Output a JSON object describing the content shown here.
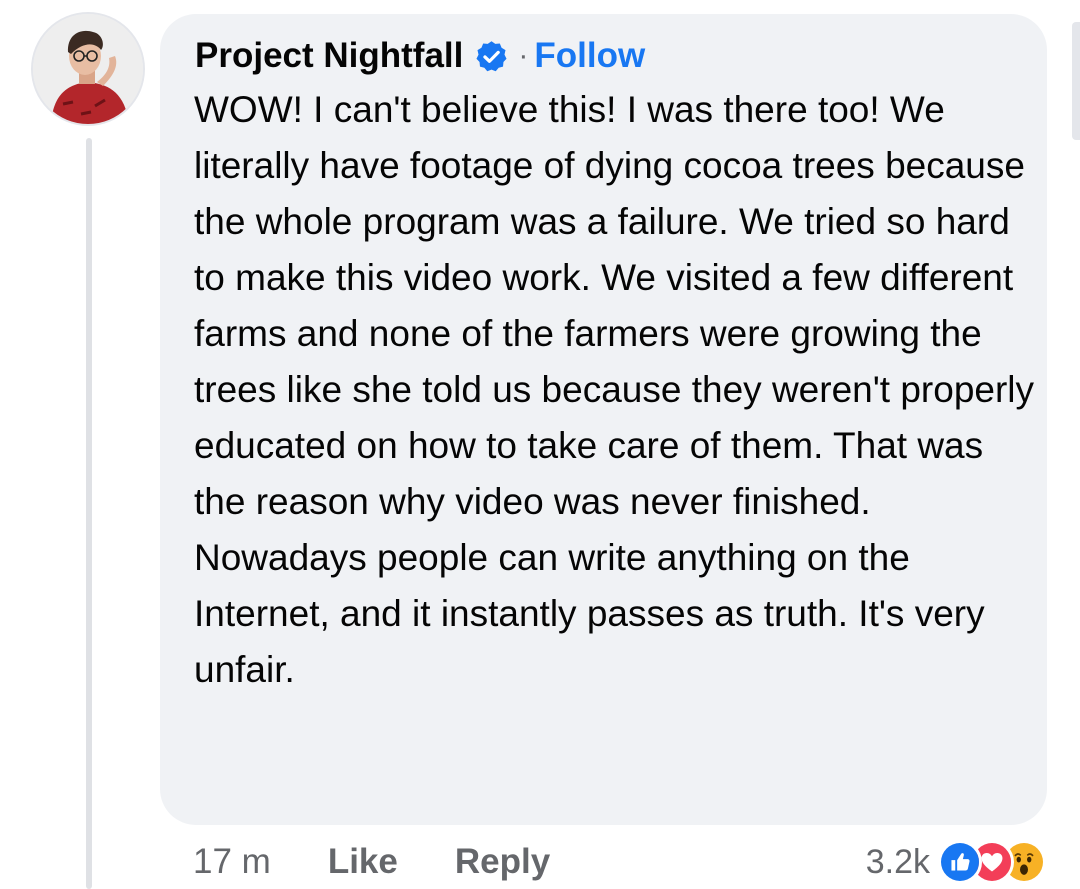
{
  "comment": {
    "author": "Project Nightfall",
    "verified_icon": "verified-badge-icon",
    "separator": "·",
    "follow_label": "Follow",
    "avatar_icon": "profile-photo",
    "text": "WOW! I can't believe this! I was there too! We literally have footage of dying cocoa trees because the whole program was a failure. We tried so hard to make this video work. We visited a few different farms and none of the farmers were growing the trees like she told us because they weren't properly educated on how to take care of them. That was the reason why video was never finished. Nowadays people can write anything on the Internet, and it instantly passes as truth. It's very unfair."
  },
  "actions": {
    "timestamp": "17 m",
    "like_label": "Like",
    "reply_label": "Reply"
  },
  "reactions": {
    "count": "3.2k",
    "icons": [
      "like-reaction-icon",
      "love-reaction-icon",
      "wow-reaction-icon"
    ]
  },
  "colors": {
    "link_blue": "#1877f2",
    "bubble_bg": "#f0f2f5",
    "meta_gray": "#65676b",
    "love_red": "#f33e58",
    "wow_yellow": "#f7b125"
  }
}
